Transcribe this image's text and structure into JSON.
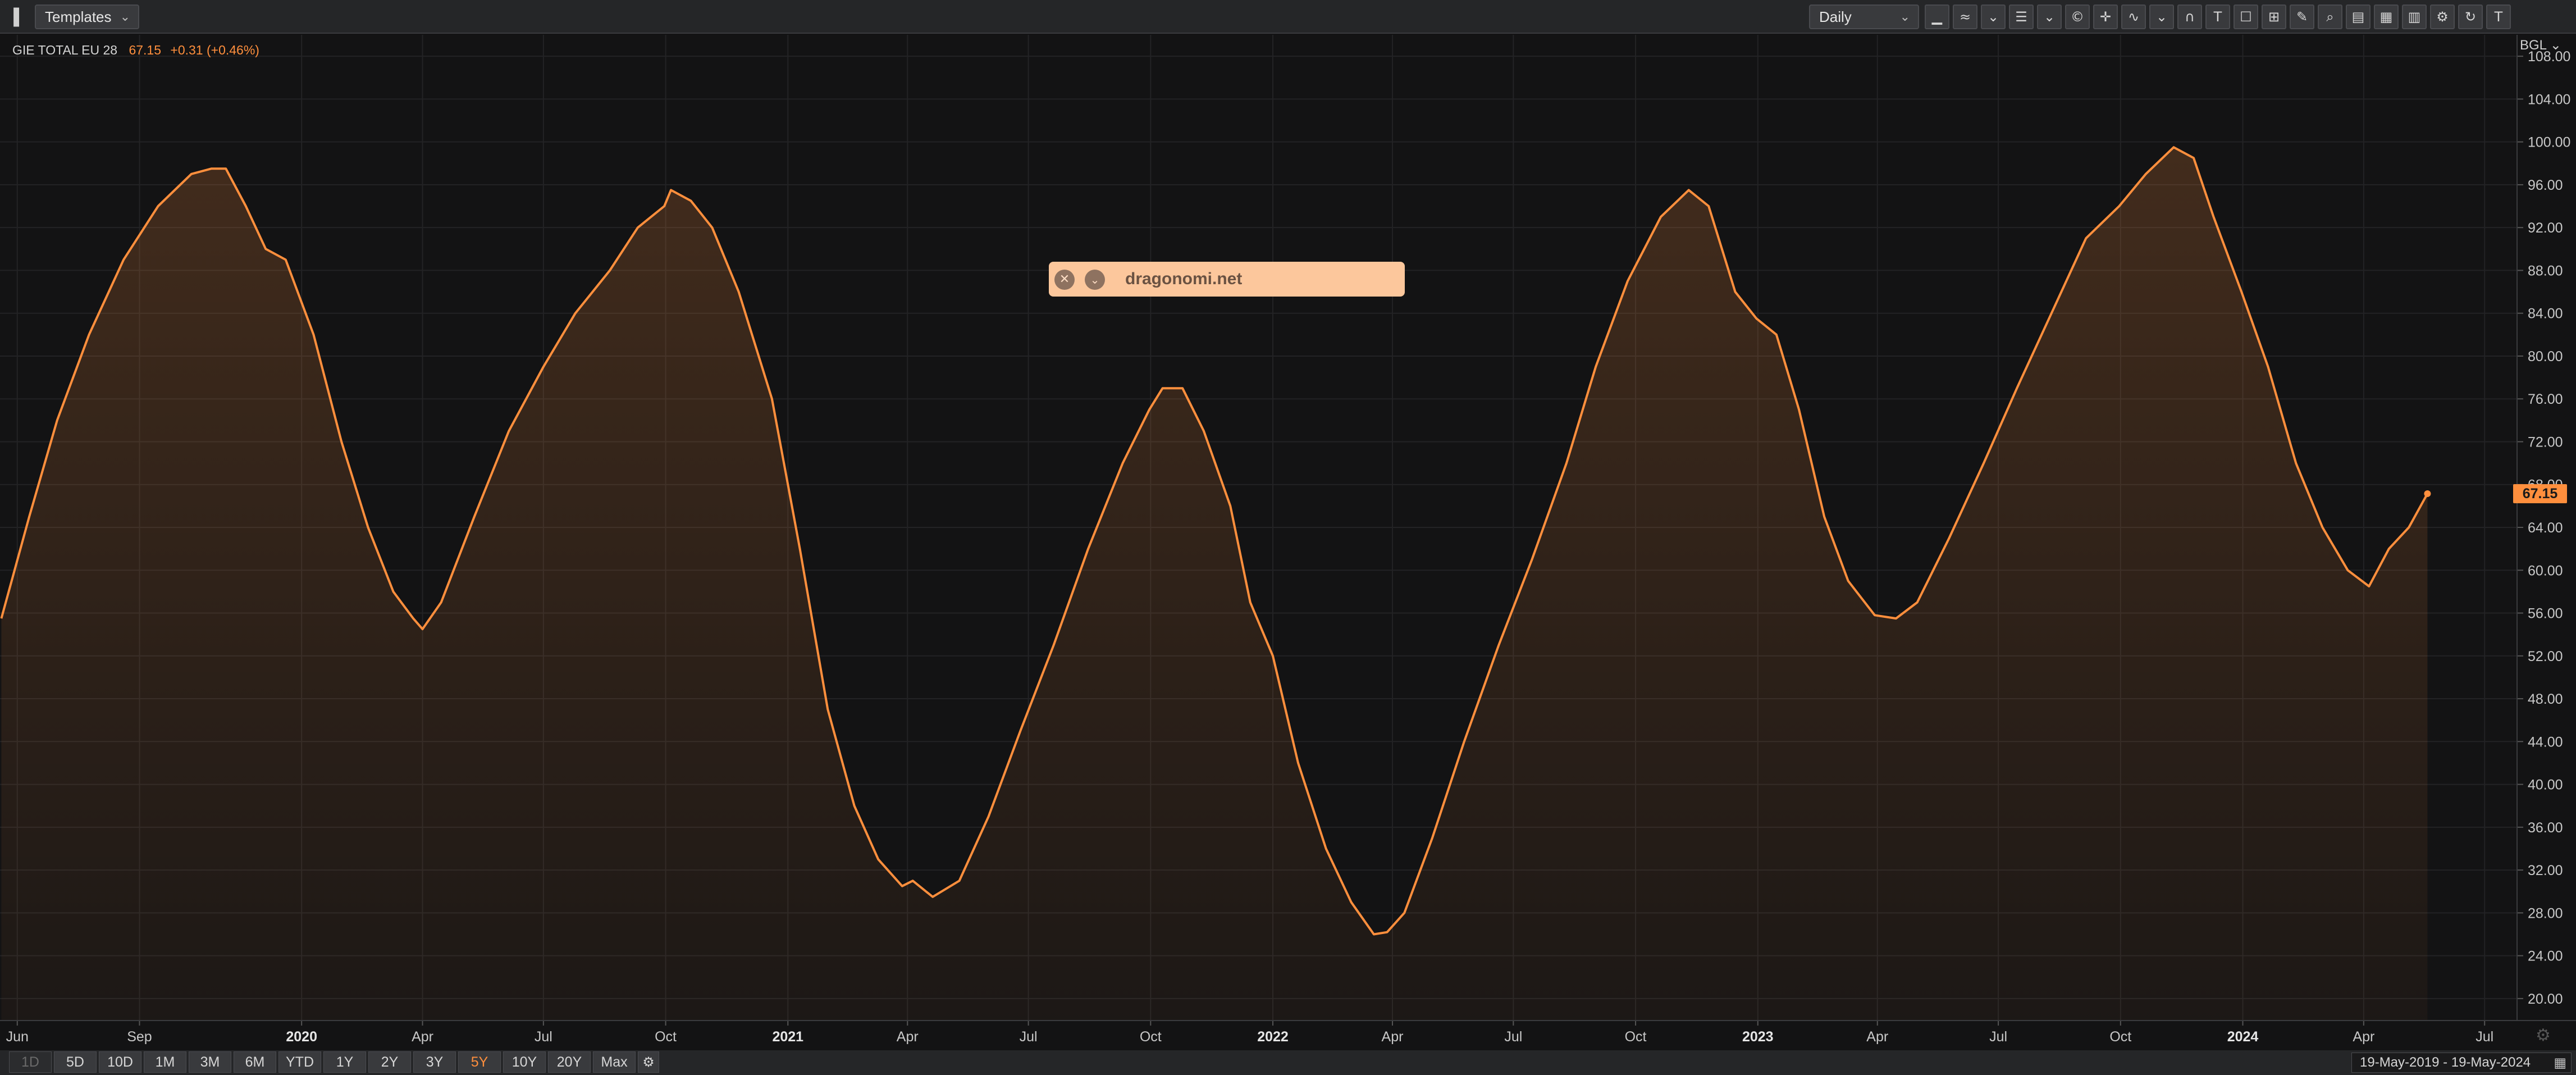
{
  "toolbar": {
    "panel_toggle_icon": "panel-toggle-icon",
    "templates_label": "Templates",
    "interval_label": "Daily",
    "tool_icons": [
      "line-style-icon",
      "indicator-icon",
      "chevron-down-icon",
      "list-icon",
      "chevron-down-icon",
      "currency-icon",
      "crosshair-icon",
      "wave-icon",
      "chevron-down-icon",
      "magnet-icon",
      "text-icon",
      "select-box-icon",
      "zoom-box-icon",
      "annotation-icon",
      "zoom-icon",
      "layout-icon",
      "grid-icon",
      "panel-icon",
      "settings-icon",
      "refresh-icon",
      "brand-icon"
    ]
  },
  "legend": {
    "name": "GIE TOTAL EU 28",
    "value": "67.15",
    "change": "+0.31 (+0.46%)"
  },
  "axis_menu": "BGL",
  "price_badge": "67.15",
  "watermark": {
    "label": "dragonomi.net",
    "close_icon": "close-icon",
    "expand_icon": "chevron-down-icon"
  },
  "range": {
    "buttons": [
      "1D",
      "5D",
      "10D",
      "1M",
      "3M",
      "6M",
      "YTD",
      "1Y",
      "2Y",
      "3Y",
      "5Y",
      "10Y",
      "20Y",
      "Max"
    ],
    "active": "5Y",
    "disabled": "1D",
    "date_range": "19-May-2019  -  19-May-2024"
  },
  "colors": {
    "line": "#ff8f3d",
    "background": "#131314",
    "grid": "#232325",
    "axis_text": "#c8c8c8"
  },
  "chart_data": {
    "type": "area",
    "title": "GIE TOTAL EU 28",
    "xlabel": "",
    "ylabel": "",
    "ylim": [
      18,
      110
    ],
    "xlim": [
      "2019-05-19",
      "2024-07-25"
    ],
    "yticks": [
      "20.00",
      "24.00",
      "28.00",
      "32.00",
      "36.00",
      "40.00",
      "44.00",
      "48.00",
      "52.00",
      "56.00",
      "60.00",
      "64.00",
      "68.00",
      "72.00",
      "76.00",
      "80.00",
      "84.00",
      "88.00",
      "92.00",
      "96.00",
      "100.00",
      "104.00",
      "108.00"
    ],
    "xticks": [
      {
        "date": "2019-06-01",
        "label": "Jun",
        "bold": false
      },
      {
        "date": "2019-09-01",
        "label": "Sep",
        "bold": false
      },
      {
        "date": "2020-01-01",
        "label": "2020",
        "bold": true
      },
      {
        "date": "2020-04-01",
        "label": "Apr",
        "bold": false
      },
      {
        "date": "2020-07-01",
        "label": "Jul",
        "bold": false
      },
      {
        "date": "2020-10-01",
        "label": "Oct",
        "bold": false
      },
      {
        "date": "2021-01-01",
        "label": "2021",
        "bold": true
      },
      {
        "date": "2021-04-01",
        "label": "Apr",
        "bold": false
      },
      {
        "date": "2021-07-01",
        "label": "Jul",
        "bold": false
      },
      {
        "date": "2021-10-01",
        "label": "Oct",
        "bold": false
      },
      {
        "date": "2022-01-01",
        "label": "2022",
        "bold": true
      },
      {
        "date": "2022-04-01",
        "label": "Apr",
        "bold": false
      },
      {
        "date": "2022-07-01",
        "label": "Jul",
        "bold": false
      },
      {
        "date": "2022-10-01",
        "label": "Oct",
        "bold": false
      },
      {
        "date": "2023-01-01",
        "label": "2023",
        "bold": true
      },
      {
        "date": "2023-04-01",
        "label": "Apr",
        "bold": false
      },
      {
        "date": "2023-07-01",
        "label": "Jul",
        "bold": false
      },
      {
        "date": "2023-10-01",
        "label": "Oct",
        "bold": false
      },
      {
        "date": "2024-01-01",
        "label": "2024",
        "bold": true
      },
      {
        "date": "2024-04-01",
        "label": "Apr",
        "bold": false
      },
      {
        "date": "2024-07-01",
        "label": "Jul",
        "bold": false
      }
    ],
    "grid": true,
    "series": [
      {
        "points": [
          [
            "2019-05-20",
            55.5
          ],
          [
            "2019-06-10",
            65
          ],
          [
            "2019-07-01",
            74
          ],
          [
            "2019-07-25",
            82
          ],
          [
            "2019-08-20",
            89
          ],
          [
            "2019-09-15",
            94
          ],
          [
            "2019-10-10",
            97
          ],
          [
            "2019-10-25",
            97.5
          ],
          [
            "2019-11-05",
            97.5
          ],
          [
            "2019-11-20",
            94
          ],
          [
            "2019-12-05",
            90
          ],
          [
            "2019-12-20",
            89
          ],
          [
            "2020-01-10",
            82
          ],
          [
            "2020-01-31",
            72
          ],
          [
            "2020-02-20",
            64
          ],
          [
            "2020-03-10",
            58
          ],
          [
            "2020-03-25",
            55.5
          ],
          [
            "2020-04-01",
            54.5
          ],
          [
            "2020-04-15",
            57
          ],
          [
            "2020-05-10",
            65
          ],
          [
            "2020-06-05",
            73
          ],
          [
            "2020-07-01",
            79
          ],
          [
            "2020-07-25",
            84
          ],
          [
            "2020-08-20",
            88
          ],
          [
            "2020-09-10",
            92
          ],
          [
            "2020-09-30",
            94
          ],
          [
            "2020-10-05",
            95.5
          ],
          [
            "2020-10-20",
            94.5
          ],
          [
            "2020-11-05",
            92
          ],
          [
            "2020-11-25",
            86
          ],
          [
            "2020-12-20",
            76
          ],
          [
            "2021-01-10",
            62
          ],
          [
            "2021-01-31",
            47
          ],
          [
            "2021-02-20",
            38
          ],
          [
            "2021-03-10",
            33
          ],
          [
            "2021-03-28",
            30.5
          ],
          [
            "2021-04-05",
            31
          ],
          [
            "2021-04-20",
            29.5
          ],
          [
            "2021-05-10",
            31
          ],
          [
            "2021-06-01",
            37
          ],
          [
            "2021-06-25",
            45
          ],
          [
            "2021-07-20",
            53
          ],
          [
            "2021-08-15",
            62
          ],
          [
            "2021-09-10",
            70
          ],
          [
            "2021-09-30",
            75
          ],
          [
            "2021-10-10",
            77
          ],
          [
            "2021-10-25",
            77
          ],
          [
            "2021-11-10",
            73
          ],
          [
            "2021-11-30",
            66
          ],
          [
            "2021-12-15",
            57
          ],
          [
            "2022-01-01",
            52
          ],
          [
            "2022-01-20",
            42
          ],
          [
            "2022-02-10",
            34
          ],
          [
            "2022-03-01",
            29
          ],
          [
            "2022-03-18",
            26
          ],
          [
            "2022-03-28",
            26.2
          ],
          [
            "2022-04-10",
            28
          ],
          [
            "2022-05-01",
            35
          ],
          [
            "2022-05-25",
            44
          ],
          [
            "2022-06-20",
            53
          ],
          [
            "2022-07-15",
            61
          ],
          [
            "2022-08-10",
            70
          ],
          [
            "2022-09-01",
            79
          ],
          [
            "2022-09-25",
            87
          ],
          [
            "2022-10-20",
            93
          ],
          [
            "2022-11-10",
            95.5
          ],
          [
            "2022-11-25",
            94
          ],
          [
            "2022-12-15",
            86
          ],
          [
            "2022-12-31",
            83.5
          ],
          [
            "2023-01-15",
            82
          ],
          [
            "2023-02-01",
            75
          ],
          [
            "2023-02-20",
            65
          ],
          [
            "2023-03-10",
            59
          ],
          [
            "2023-03-30",
            55.8
          ],
          [
            "2023-04-15",
            55.5
          ],
          [
            "2023-05-01",
            57
          ],
          [
            "2023-05-25",
            63
          ],
          [
            "2023-06-20",
            70
          ],
          [
            "2023-07-15",
            77
          ],
          [
            "2023-08-10",
            84
          ],
          [
            "2023-09-05",
            91
          ],
          [
            "2023-09-30",
            94
          ],
          [
            "2023-10-20",
            97
          ],
          [
            "2023-11-10",
            99.5
          ],
          [
            "2023-11-25",
            98.5
          ],
          [
            "2023-12-10",
            93
          ],
          [
            "2023-12-31",
            86
          ],
          [
            "2024-01-20",
            79
          ],
          [
            "2024-02-10",
            70
          ],
          [
            "2024-03-01",
            64
          ],
          [
            "2024-03-20",
            60
          ],
          [
            "2024-04-05",
            58.5
          ],
          [
            "2024-04-20",
            62
          ],
          [
            "2024-05-05",
            64
          ],
          [
            "2024-05-19",
            67.15
          ]
        ]
      }
    ]
  }
}
